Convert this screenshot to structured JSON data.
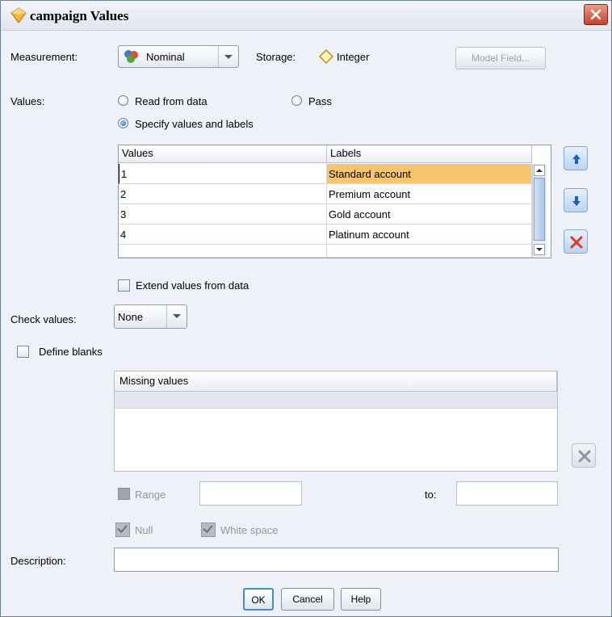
{
  "window": {
    "title": "campaign Values"
  },
  "measurement": {
    "label": "Measurement:",
    "value": "Nominal"
  },
  "storage": {
    "label": "Storage:",
    "value": "Integer"
  },
  "model_field_button": "Model Field...",
  "values_section": {
    "label": "Values:",
    "options": [
      "Read from data",
      "Pass",
      "Specify values and labels"
    ],
    "selected": "Specify values and labels"
  },
  "values_table": {
    "columns": [
      "Values",
      "Labels"
    ],
    "rows": [
      {
        "value": "1",
        "label": "Standard account"
      },
      {
        "value": "2",
        "label": "Premium account"
      },
      {
        "value": "3",
        "label": "Gold account"
      },
      {
        "value": "4",
        "label": "Platinum account"
      },
      {
        "value": "",
        "label": ""
      }
    ],
    "selected_row": 0
  },
  "extend_values": {
    "label": "Extend values from data",
    "checked": false
  },
  "check_values": {
    "label": "Check values:",
    "value": "None"
  },
  "define_blanks": {
    "label": "Define blanks",
    "checked": false
  },
  "missing_values": {
    "header": "Missing values"
  },
  "range": {
    "label": "Range",
    "to_label": "to:"
  },
  "null_check": {
    "label": "Null",
    "checked": true
  },
  "white_space_check": {
    "label": "White space",
    "checked": true
  },
  "description": {
    "label": "Description:",
    "value": ""
  },
  "buttons": {
    "ok": "OK",
    "cancel": "Cancel",
    "help": "Help"
  },
  "colors": {
    "selected_row": "#f6c56e",
    "close_button": "#c9422a",
    "delete_icon": "#e0391f"
  }
}
